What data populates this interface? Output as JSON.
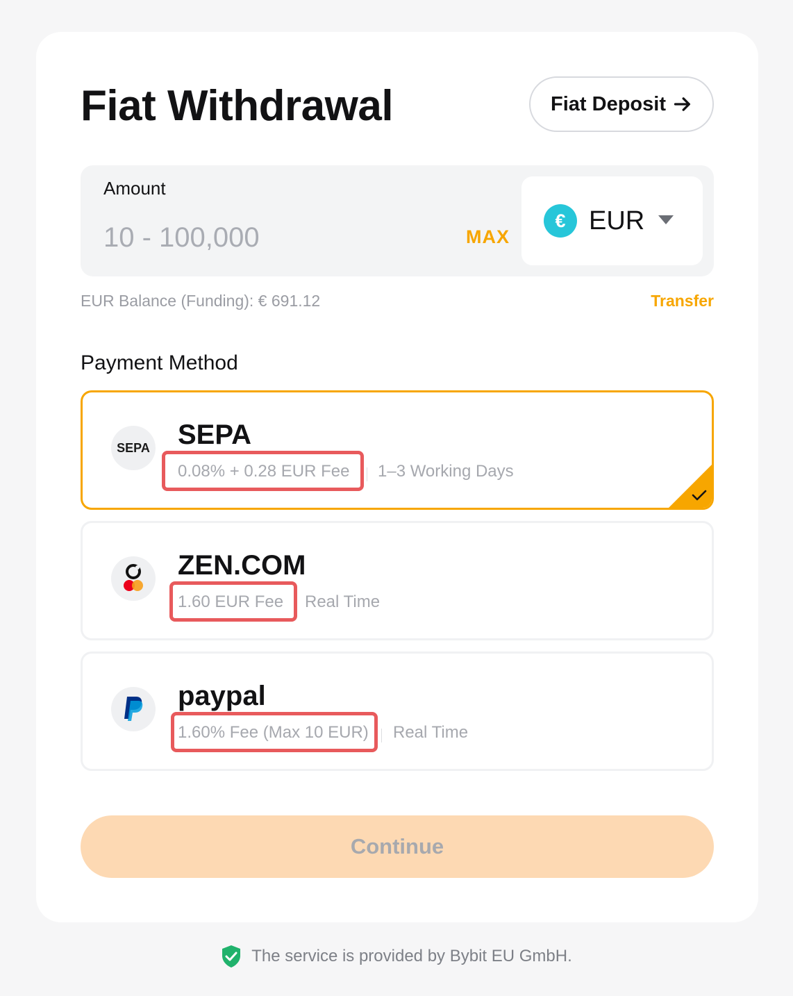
{
  "header": {
    "title": "Fiat Withdrawal",
    "deposit_label": "Fiat Deposit",
    "deposit_icon": "arrow-right-icon"
  },
  "amount": {
    "label": "Amount",
    "value": "",
    "placeholder": "10 - 100,000",
    "max_label": "MAX",
    "currency": "EUR",
    "currency_symbol": "€",
    "currency_icon_color": "#27c6d9"
  },
  "balance": {
    "text": "EUR Balance (Funding): € 691.12",
    "transfer_label": "Transfer"
  },
  "payment": {
    "heading": "Payment Method",
    "methods": [
      {
        "name": "SEPA",
        "logo": "sepa-logo",
        "logo_text": "SEPA",
        "fee": "0.08% + 0.28 EUR Fee",
        "time": "1–3 Working Days",
        "selected": true
      },
      {
        "name": "ZEN.COM",
        "logo": "zen-logo",
        "fee": "1.60 EUR Fee",
        "time": "Real Time",
        "selected": false
      },
      {
        "name": "paypal",
        "logo": "paypal-logo",
        "fee": "1.60% Fee (Max 10 EUR)",
        "time": "Real Time",
        "selected": false
      }
    ]
  },
  "continue_label": "Continue",
  "footer": {
    "text": "The service is provided by Bybit EU GmbH.",
    "icon": "shield-check-icon"
  },
  "colors": {
    "accent": "#f7a600",
    "highlight_box": "#e85a5c",
    "continue_bg": "#fdd9b3",
    "shield": "#20b26c"
  }
}
